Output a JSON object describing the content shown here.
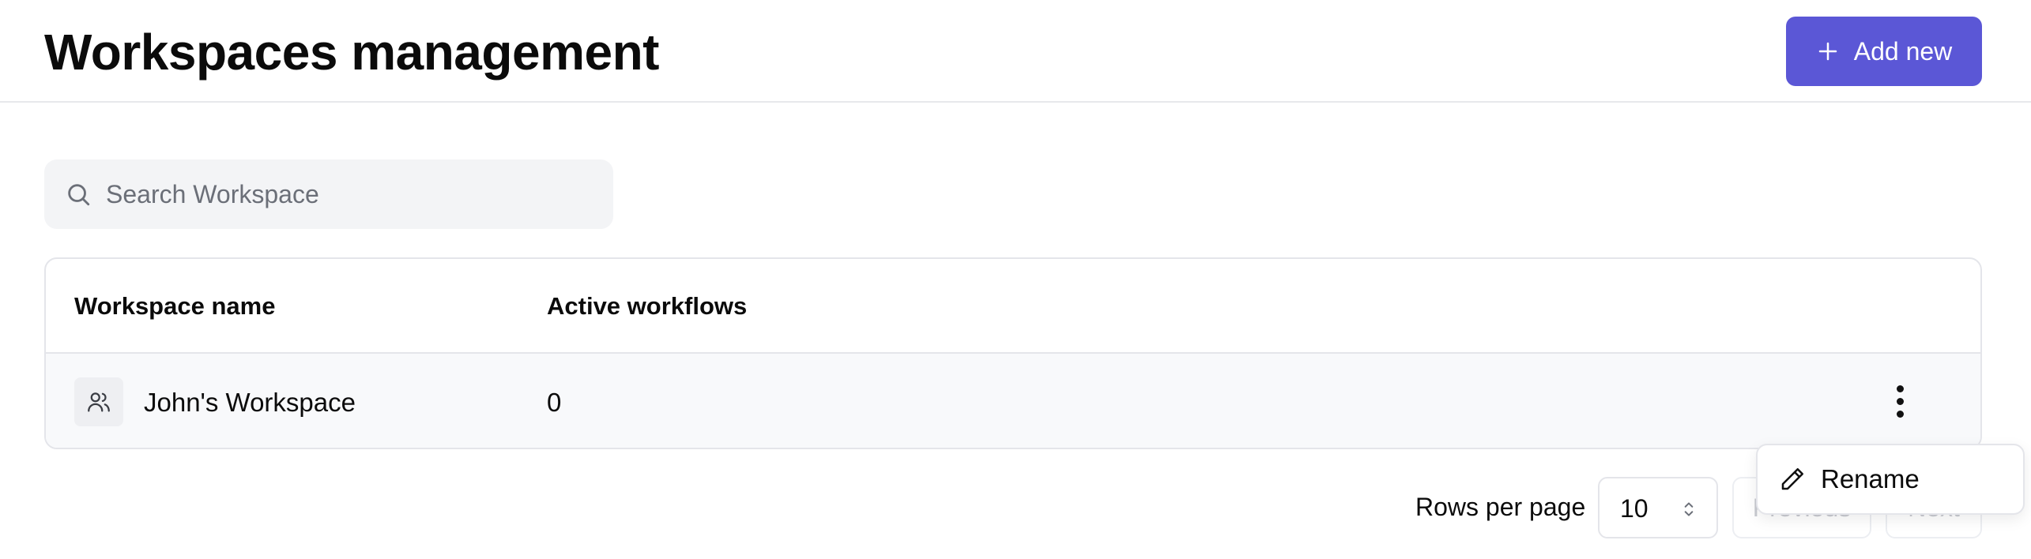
{
  "header": {
    "title": "Workspaces management",
    "add_button_label": "Add new",
    "accent_color": "#5b57d6"
  },
  "search": {
    "placeholder": "Search Workspace",
    "value": ""
  },
  "table": {
    "columns": [
      "Workspace name",
      "Active workflows"
    ],
    "rows": [
      {
        "name": "John's Workspace",
        "active_workflows": "0",
        "icon": "users-icon"
      }
    ]
  },
  "pagination": {
    "rows_per_page_label": "Rows per page",
    "rows_per_page_value": "10",
    "previous_label": "Previous",
    "next_label": "Next"
  },
  "row_menu": {
    "items": [
      {
        "label": "Rename",
        "icon": "pencil-icon"
      }
    ]
  }
}
